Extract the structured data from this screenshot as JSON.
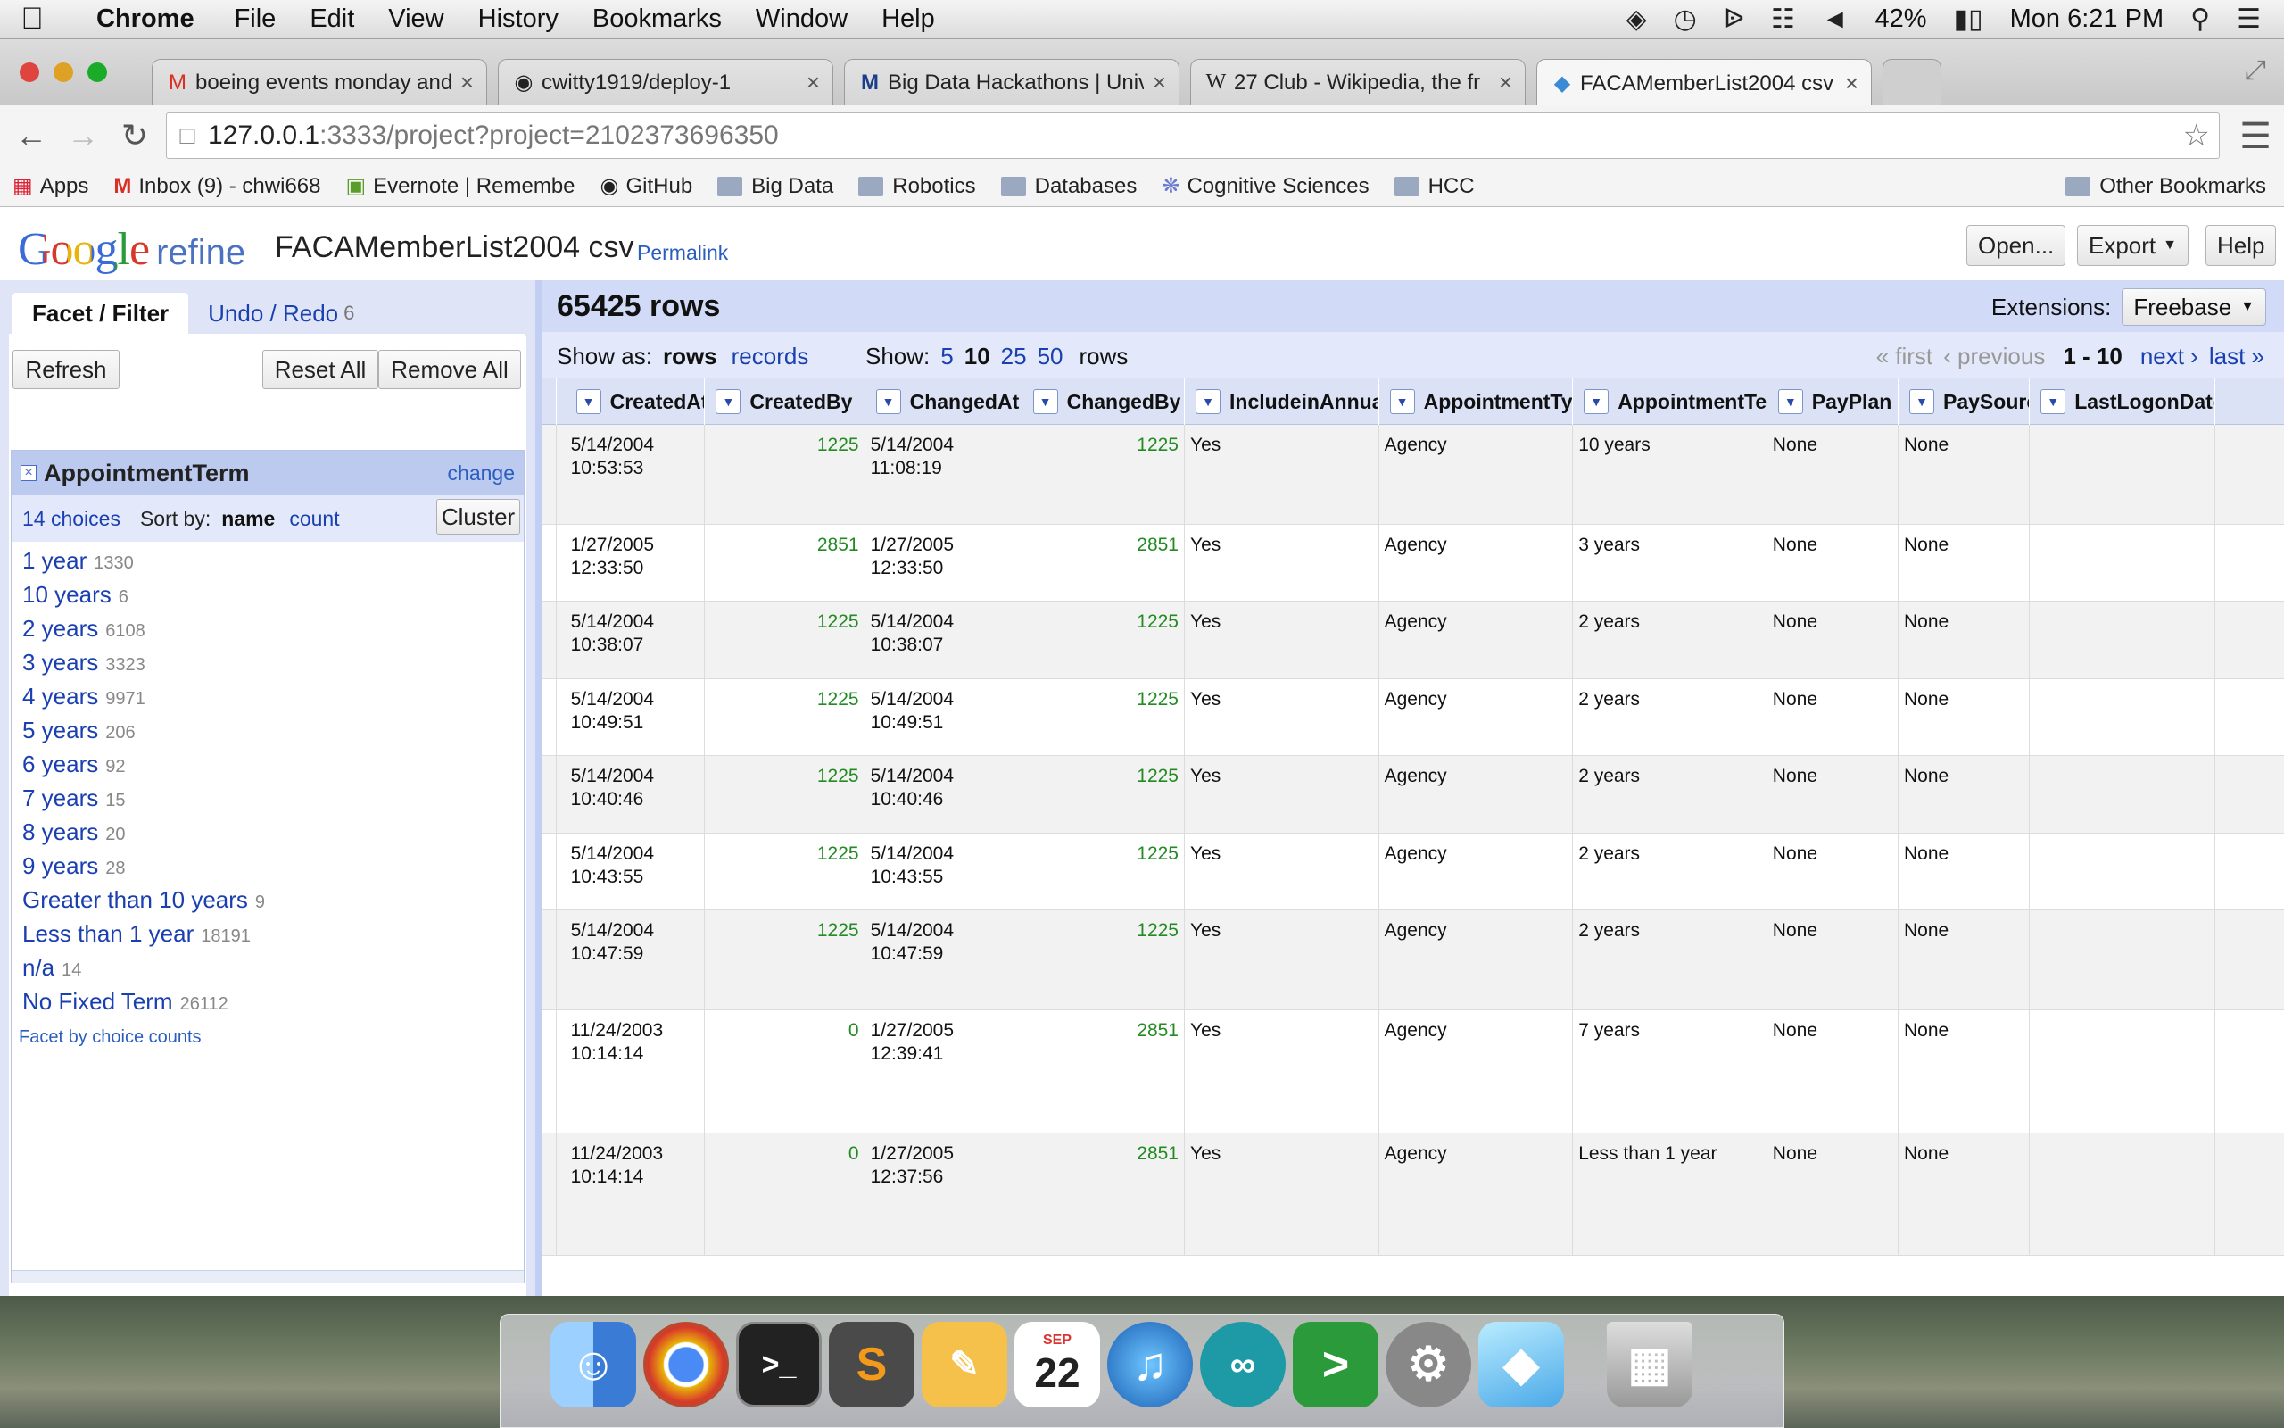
{
  "menubar": {
    "app": "Chrome",
    "items": [
      "File",
      "Edit",
      "View",
      "History",
      "Bookmarks",
      "Window",
      "Help"
    ],
    "battery": "42%",
    "clock": "Mon 6:21 PM"
  },
  "tabs": [
    {
      "icon": "gmail-icon",
      "title": "boeing events monday and"
    },
    {
      "icon": "github-icon",
      "title": "cwitty1919/deploy-1"
    },
    {
      "icon": "m-icon",
      "title": "Big Data Hackathons | Univ"
    },
    {
      "icon": "wikipedia-icon",
      "title": "27 Club - Wikipedia, the fr"
    },
    {
      "icon": "refine-icon",
      "title": "FACAMemberList2004 csv"
    }
  ],
  "address": {
    "host": "127.0.0.1",
    "path": ":3333/project?project=2102373696350"
  },
  "bookmarks": {
    "items": [
      "Apps",
      "Inbox (9) - chwi668",
      "Evernote | Remembe",
      "GitHub",
      "Big Data",
      "Robotics",
      "Databases",
      "Cognitive Sciences",
      "HCC"
    ],
    "other": "Other Bookmarks"
  },
  "header": {
    "logo_google": "Google",
    "logo_refine": "refine",
    "project_title": "FACAMemberList2004 csv",
    "permalink": "Permalink",
    "buttons": {
      "open": "Open...",
      "export": "Export",
      "help": "Help"
    }
  },
  "left": {
    "tab_facet": "Facet / Filter",
    "tab_undo": "Undo / Redo",
    "undo_count": "6",
    "refresh": "Refresh",
    "reset_all": "Reset All",
    "remove_all": "Remove All",
    "facet": {
      "title": "AppointmentTerm",
      "change": "change",
      "choices_label": "14 choices",
      "sort_by": "Sort by:",
      "sort_name": "name",
      "sort_count": "count",
      "cluster": "Cluster",
      "items": [
        {
          "name": "1 year",
          "count": "1330"
        },
        {
          "name": "10 years",
          "count": "6"
        },
        {
          "name": "2 years",
          "count": "6108"
        },
        {
          "name": "3 years",
          "count": "3323"
        },
        {
          "name": "4 years",
          "count": "9971"
        },
        {
          "name": "5 years",
          "count": "206"
        },
        {
          "name": "6 years",
          "count": "92"
        },
        {
          "name": "7 years",
          "count": "15"
        },
        {
          "name": "8 years",
          "count": "20"
        },
        {
          "name": "9 years",
          "count": "28"
        },
        {
          "name": "Greater than 10 years",
          "count": "9"
        },
        {
          "name": "Less than 1 year",
          "count": "18191"
        },
        {
          "name": "n/a",
          "count": "14"
        },
        {
          "name": "No Fixed Term",
          "count": "26112"
        }
      ],
      "facet_by_counts": "Facet by choice counts"
    }
  },
  "grid": {
    "row_count": "65425 rows",
    "extensions_label": "Extensions:",
    "extensions_value": "Freebase",
    "show_as": "Show as:",
    "show_rows": "rows",
    "show_records": "records",
    "show_label": "Show:",
    "page_sizes": [
      "5",
      "10",
      "25",
      "50"
    ],
    "page_size_selected": "10",
    "rows_word": "rows",
    "first": "« first",
    "previous": "‹ previous",
    "range": "1 - 10",
    "next": "next ›",
    "last": "last »",
    "columns": [
      "CreatedAt",
      "CreatedBy",
      "ChangedAt",
      "ChangedBy",
      "IncludeinAnnual",
      "AppointmentTyp",
      "AppointmentTer",
      "PayPlan",
      "PaySource",
      "LastLogonDate"
    ],
    "rows": [
      {
        "CreatedAt": [
          "5/14/2004",
          "10:53:53"
        ],
        "CreatedBy": "1225",
        "ChangedAt": [
          "5/14/2004",
          "11:08:19"
        ],
        "ChangedBy": "1225",
        "IncludeinAnnual": "Yes",
        "AppointmentTyp": "Agency",
        "AppointmentTer": "10 years",
        "PayPlan": "None",
        "PaySource": "None",
        "LastLogonDate": ""
      },
      {
        "CreatedAt": [
          "1/27/2005",
          "12:33:50"
        ],
        "CreatedBy": "2851",
        "ChangedAt": [
          "1/27/2005",
          "12:33:50"
        ],
        "ChangedBy": "2851",
        "IncludeinAnnual": "Yes",
        "AppointmentTyp": "Agency",
        "AppointmentTer": "3 years",
        "PayPlan": "None",
        "PaySource": "None",
        "LastLogonDate": ""
      },
      {
        "CreatedAt": [
          "5/14/2004",
          "10:38:07"
        ],
        "CreatedBy": "1225",
        "ChangedAt": [
          "5/14/2004",
          "10:38:07"
        ],
        "ChangedBy": "1225",
        "IncludeinAnnual": "Yes",
        "AppointmentTyp": "Agency",
        "AppointmentTer": "2 years",
        "PayPlan": "None",
        "PaySource": "None",
        "LastLogonDate": ""
      },
      {
        "CreatedAt": [
          "5/14/2004",
          "10:49:51"
        ],
        "CreatedBy": "1225",
        "ChangedAt": [
          "5/14/2004",
          "10:49:51"
        ],
        "ChangedBy": "1225",
        "IncludeinAnnual": "Yes",
        "AppointmentTyp": "Agency",
        "AppointmentTer": "2 years",
        "PayPlan": "None",
        "PaySource": "None",
        "LastLogonDate": ""
      },
      {
        "CreatedAt": [
          "5/14/2004",
          "10:40:46"
        ],
        "CreatedBy": "1225",
        "ChangedAt": [
          "5/14/2004",
          "10:40:46"
        ],
        "ChangedBy": "1225",
        "IncludeinAnnual": "Yes",
        "AppointmentTyp": "Agency",
        "AppointmentTer": "2 years",
        "PayPlan": "None",
        "PaySource": "None",
        "LastLogonDate": ""
      },
      {
        "CreatedAt": [
          "5/14/2004",
          "10:43:55"
        ],
        "CreatedBy": "1225",
        "ChangedAt": [
          "5/14/2004",
          "10:43:55"
        ],
        "ChangedBy": "1225",
        "IncludeinAnnual": "Yes",
        "AppointmentTyp": "Agency",
        "AppointmentTer": "2 years",
        "PayPlan": "None",
        "PaySource": "None",
        "LastLogonDate": ""
      },
      {
        "CreatedAt": [
          "5/14/2004",
          "10:47:59"
        ],
        "CreatedBy": "1225",
        "ChangedAt": [
          "5/14/2004",
          "10:47:59"
        ],
        "ChangedBy": "1225",
        "IncludeinAnnual": "Yes",
        "AppointmentTyp": "Agency",
        "AppointmentTer": "2 years",
        "PayPlan": "None",
        "PaySource": "None",
        "LastLogonDate": ""
      },
      {
        "CreatedAt": [
          "11/24/2003",
          "10:14:14"
        ],
        "CreatedBy": "0",
        "ChangedAt": [
          "1/27/2005",
          "12:39:41"
        ],
        "ChangedBy": "2851",
        "IncludeinAnnual": "Yes",
        "AppointmentTyp": "Agency",
        "AppointmentTer": "7 years",
        "PayPlan": "None",
        "PaySource": "None",
        "LastLogonDate": ""
      },
      {
        "CreatedAt": [
          "11/24/2003",
          "10:14:14"
        ],
        "CreatedBy": "0",
        "ChangedAt": [
          "1/27/2005",
          "12:37:56"
        ],
        "ChangedBy": "2851",
        "IncludeinAnnual": "Yes",
        "AppointmentTyp": "Agency",
        "AppointmentTer": "Less than 1 year",
        "PayPlan": "None",
        "PaySource": "None",
        "LastLogonDate": ""
      }
    ]
  },
  "dock": {
    "apps": [
      "finder-icon",
      "chrome-icon",
      "terminal-icon",
      "sublime-icon",
      "pages-icon",
      "calendar-icon",
      "itunes-icon",
      "arduino-icon",
      "launcher-icon",
      "system-preferences-icon",
      "sketch-icon",
      "trash-icon"
    ],
    "calendar_month": "SEP",
    "calendar_day": "22"
  }
}
